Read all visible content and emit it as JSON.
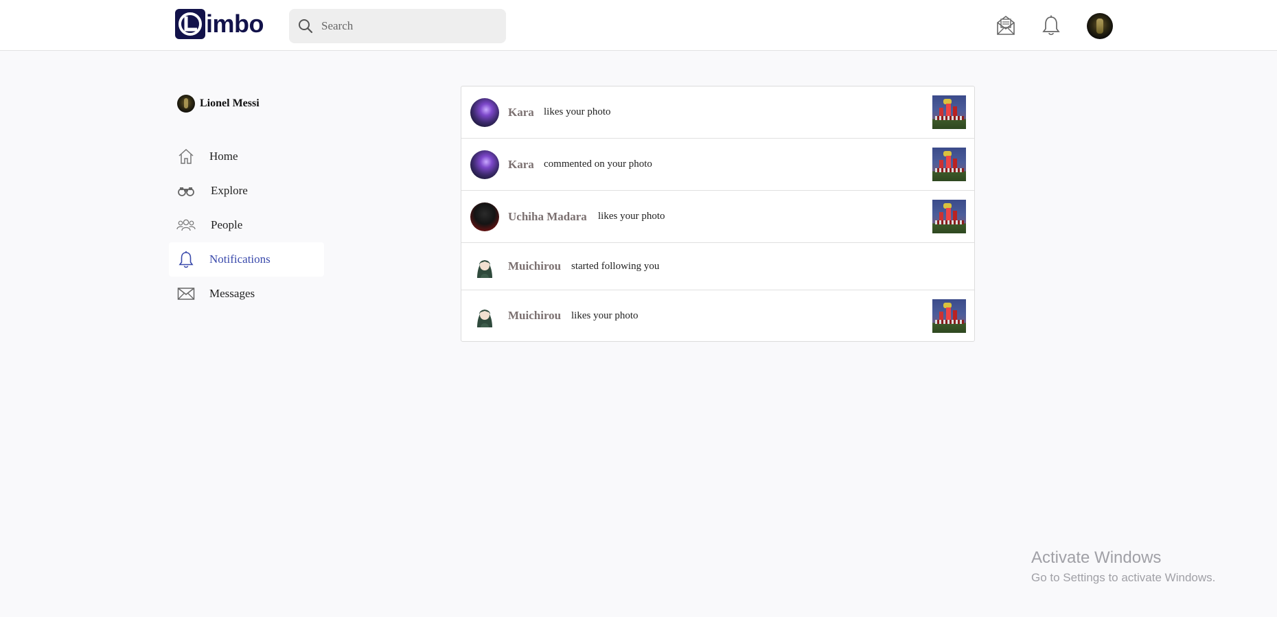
{
  "app": {
    "logo_text": "imbo"
  },
  "search": {
    "placeholder": "Search"
  },
  "header": {
    "icons": [
      "mail-open-icon",
      "bell-icon"
    ]
  },
  "profile": {
    "name": "Lionel Messi"
  },
  "nav": {
    "items": [
      {
        "label": "Home",
        "icon": "home-icon"
      },
      {
        "label": "Explore",
        "icon": "binoculars-icon"
      },
      {
        "label": "People",
        "icon": "people-icon"
      },
      {
        "label": "Notifications",
        "icon": "bell-icon",
        "active": true
      },
      {
        "label": "Messages",
        "icon": "envelope-icon"
      }
    ]
  },
  "notifications": [
    {
      "name": "Kara",
      "text": "likes your photo",
      "avatar": "kara",
      "has_thumb": true
    },
    {
      "name": "Kara",
      "text": "commented on your photo",
      "avatar": "kara",
      "has_thumb": true
    },
    {
      "name": "Uchiha Madara",
      "text": "likes your photo",
      "avatar": "madara",
      "has_thumb": true
    },
    {
      "name": "Muichirou",
      "text": "started following you",
      "avatar": "muichirou",
      "has_thumb": false
    },
    {
      "name": "Muichirou",
      "text": "likes your photo",
      "avatar": "muichirou",
      "has_thumb": true
    }
  ],
  "watermark": {
    "title": "Activate Windows",
    "subtitle": "Go to Settings to activate Windows."
  },
  "colors": {
    "brand": "#12124a",
    "active": "#3949ab",
    "name_text": "#7b7070",
    "background": "#f9f9fb"
  }
}
